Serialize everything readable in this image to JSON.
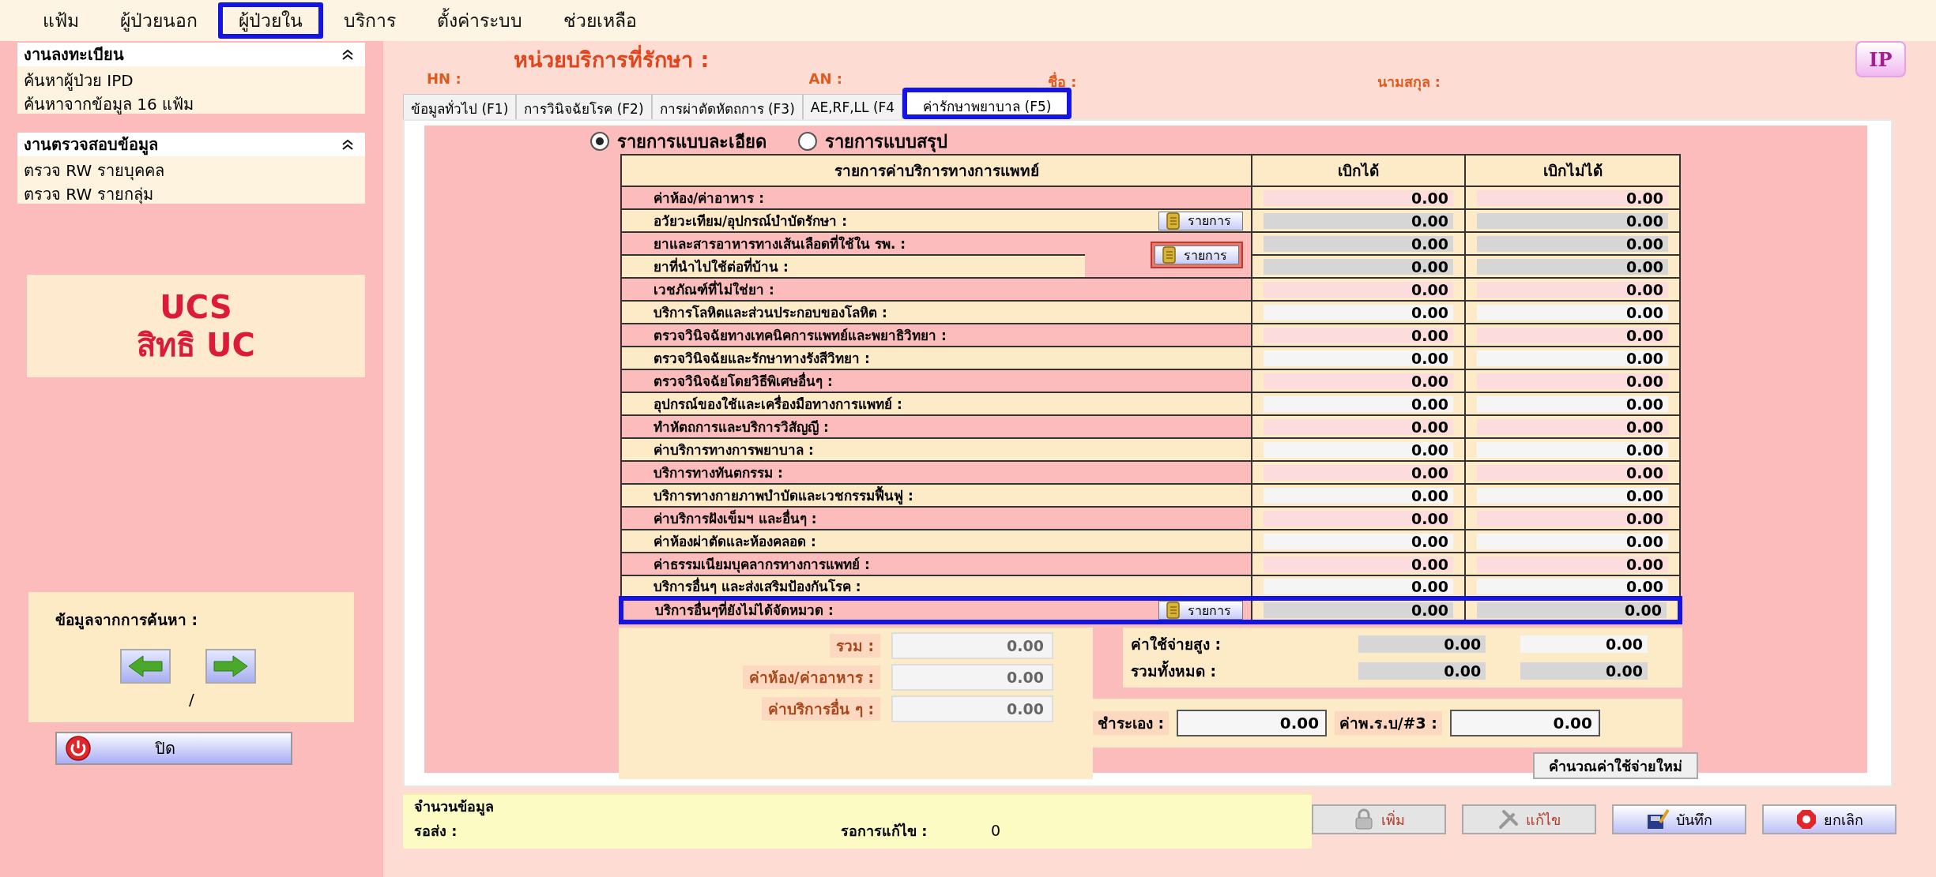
{
  "menu": [
    {
      "label": "แฟ้ม",
      "highlighted": false
    },
    {
      "label": "ผู้ป่วยนอก",
      "highlighted": false
    },
    {
      "label": "ผู้ป่วยใน",
      "highlighted": true
    },
    {
      "label": "บริการ",
      "highlighted": false
    },
    {
      "label": "ตั้งค่าระบบ",
      "highlighted": false
    },
    {
      "label": "ช่วยเหลือ",
      "highlighted": false
    }
  ],
  "sidebar": {
    "sections": [
      {
        "title": "งานลงทะเบียน",
        "expanded": true,
        "items": [
          "ค้นหาผู้ป่วย IPD",
          "ค้นหาจากข้อมูล 16 แฟ้ม"
        ]
      },
      {
        "title": "งานตรวจสอบข้อมูล",
        "expanded": true,
        "items": [
          "ตรวจ RW รายบุคคล",
          "ตรวจ RW รายกลุ่ม"
        ]
      }
    ],
    "rights_card": [
      "UCS",
      "สิทธิ UC"
    ],
    "search_result": {
      "title": "ข้อมูลจากการค้นหา :",
      "position": "/"
    },
    "close_button": "ปิด"
  },
  "header": {
    "title": "หน่วยบริการที่รักษา :",
    "fields": [
      "HN :",
      "AN :",
      "ชื่อ :",
      "นามสกุล :"
    ],
    "badge": "IP"
  },
  "tabs": [
    {
      "label": "ข้อมูลทั่วไป (F1)",
      "selected": false,
      "highlighted": false
    },
    {
      "label": "การวินิจฉัยโรค (F2)",
      "selected": false,
      "highlighted": false
    },
    {
      "label": "การผ่าตัดหัตถการ (F3)",
      "selected": false,
      "highlighted": false
    },
    {
      "label": "AE,RF,LL (F4",
      "selected": false,
      "highlighted": false
    },
    {
      "label": "ค่ารักษาพยาบาล (F5)",
      "selected": true,
      "highlighted": true
    }
  ],
  "view_options": [
    {
      "label": "รายการแบบละเอียด",
      "selected": true
    },
    {
      "label": "รายการแบบสรุป",
      "selected": false
    }
  ],
  "table": {
    "columns": [
      "รายการค่าบริการทางการแพทย์",
      "เบิกได้",
      "เบิกไม่ได้"
    ],
    "rows": [
      {
        "label": "ค่าห้อง/ค่าอาหาร :",
        "kind": "plain",
        "claimable": "0.00",
        "non_claimable": "0.00"
      },
      {
        "label": "อวัยวะเทียม/อุปกรณ์บำบัดรักษา :",
        "kind": "list",
        "list_button": {
          "label": "รายการ",
          "outlined": false,
          "spans_next_row": false
        },
        "claimable": "0.00",
        "non_claimable": "0.00"
      },
      {
        "label": "ยาและสารอาหารทางเส้นเลือดที่ใช้ใน รพ. :",
        "kind": "list",
        "list_button": {
          "label": "รายการ",
          "outlined": true,
          "spans_next_row": true
        },
        "claimable": "0.00",
        "non_claimable": "0.00"
      },
      {
        "label": "ยาที่นำไปใช้ต่อที่บ้าน :",
        "kind": "list",
        "claimable": "0.00",
        "non_claimable": "0.00"
      },
      {
        "label": "เวชภัณฑ์ที่ไม่ใช่ยา :",
        "kind": "plain",
        "claimable": "0.00",
        "non_claimable": "0.00"
      },
      {
        "label": "บริการโลหิตและส่วนประกอบของโลหิต :",
        "kind": "plain",
        "claimable": "0.00",
        "non_claimable": "0.00"
      },
      {
        "label": "ตรวจวินิจฉัยทางเทคนิคการแพทย์และพยาธิวิทยา :",
        "kind": "plain",
        "claimable": "0.00",
        "non_claimable": "0.00"
      },
      {
        "label": "ตรวจวินิจฉัยและรักษาทางรังสีวิทยา :",
        "kind": "plain",
        "claimable": "0.00",
        "non_claimable": "0.00"
      },
      {
        "label": "ตรวจวินิจฉัยโดยวิธีพิเศษอื่นๆ :",
        "kind": "plain",
        "claimable": "0.00",
        "non_claimable": "0.00"
      },
      {
        "label": "อุปกรณ์ของใช้และเครื่องมือทางการแพทย์ :",
        "kind": "plain",
        "claimable": "0.00",
        "non_claimable": "0.00"
      },
      {
        "label": "ทำหัตถการและบริการวิสัญญี :",
        "kind": "plain",
        "claimable": "0.00",
        "non_claimable": "0.00"
      },
      {
        "label": "ค่าบริการทางการพยาบาล :",
        "kind": "plain",
        "claimable": "0.00",
        "non_claimable": "0.00"
      },
      {
        "label": "บริการทางทันตกรรม :",
        "kind": "plain",
        "claimable": "0.00",
        "non_claimable": "0.00"
      },
      {
        "label": "บริการทางกายภาพบำบัดและเวชกรรมฟื้นฟู :",
        "kind": "plain",
        "claimable": "0.00",
        "non_claimable": "0.00"
      },
      {
        "label": "ค่าบริการฝังเข็มฯ และอื่นๆ :",
        "kind": "plain",
        "claimable": "0.00",
        "non_claimable": "0.00"
      },
      {
        "label": "ค่าห้องผ่าตัดและห้องคลอด :",
        "kind": "plain",
        "claimable": "0.00",
        "non_claimable": "0.00"
      },
      {
        "label": "ค่าธรรมเนียมบุคลากรทางการแพทย์ :",
        "kind": "plain",
        "claimable": "0.00",
        "non_claimable": "0.00"
      },
      {
        "label": "บริการอื่นๆ และส่งเสริมป้องกันโรค :",
        "kind": "plain",
        "claimable": "0.00",
        "non_claimable": "0.00"
      },
      {
        "label": "บริการอื่นๆที่ยังไม่ได้จัดหมวด :",
        "kind": "list",
        "highlighted": true,
        "list_button": {
          "label": "รายการ",
          "outlined": false
        },
        "claimable": "0.00",
        "non_claimable": "0.00"
      }
    ]
  },
  "subtotals": [
    {
      "label": "รวม :",
      "value": "0.00"
    },
    {
      "label": "ค่าห้อง/ค่าอาหาร :",
      "value": "0.00"
    },
    {
      "label": "ค่าบริการอื่น ๆ :",
      "value": "0.00"
    }
  ],
  "totals": [
    {
      "label": "ค่าใช้จ่ายสูง :",
      "claimable": "0.00",
      "non_claimable": "0.00",
      "non_claimable_readonly": false
    },
    {
      "label": "รวมทั้งหมด :",
      "claimable": "0.00",
      "non_claimable": "0.00",
      "non_claimable_readonly": true
    }
  ],
  "payments": [
    {
      "label": "ชำระเอง :",
      "value": "0.00"
    },
    {
      "label": "ค่าพ.ร.บ/#3 :",
      "value": "0.00"
    }
  ],
  "recalc_button": "คำนวณค่าใช้จ่ายใหม่",
  "status": {
    "title": "จำนวนข้อมูล",
    "pending_label": "รอส่ง :",
    "fix_label": "รอการแก้ไข :",
    "fix_value": "0"
  },
  "actions": [
    {
      "label": "เพิ่ม",
      "kind": "add",
      "disabled": true
    },
    {
      "label": "แก้ไข",
      "kind": "edit",
      "disabled": true
    },
    {
      "label": "บันทึก",
      "kind": "save",
      "disabled": false
    },
    {
      "label": "ยกเลิก",
      "kind": "cancel",
      "disabled": false
    }
  ]
}
